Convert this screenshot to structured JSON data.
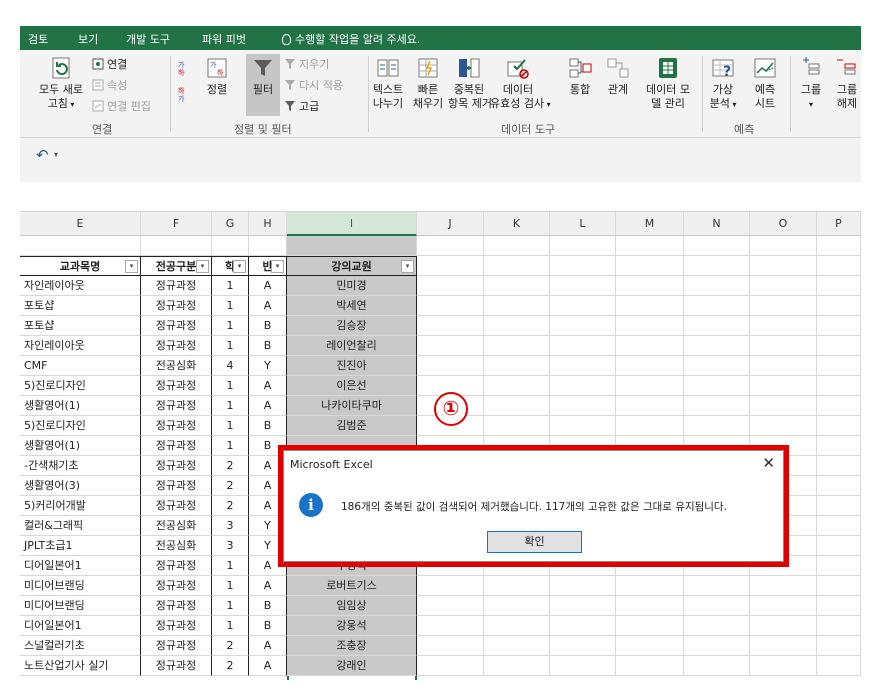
{
  "tabs": [
    "검토",
    "보기",
    "개발 도구",
    "파워 피벗"
  ],
  "tell_me": "수행할 작업을 알려 주세요.",
  "ribbon": {
    "refresh_all": "모두 새로",
    "refresh_all_2": "고침",
    "connections": "연결",
    "properties": "속성",
    "edit_links": "연결 편집",
    "group_connections": "연결",
    "sort": "정렬",
    "filter": "필터",
    "clear": "지우기",
    "reapply": "다시 적용",
    "advanced": "고급",
    "group_sort_filter": "정렬 및 필터",
    "text_to_columns": "텍스트",
    "text_to_columns_2": "나누기",
    "flash_fill": "빠른",
    "flash_fill_2": "채우기",
    "remove_duplicates": "중복된",
    "remove_duplicates_2": "항목 제거",
    "data_validation": "데이터",
    "data_validation_2": "유효성 검사",
    "consolidate": "통합",
    "relationships": "관계",
    "data_model": "데이터 모",
    "data_model_2": "델 관리",
    "group_data_tools": "데이터 도구",
    "what_if": "가상",
    "what_if_2": "분석",
    "forecast": "예측",
    "forecast_2": "시트",
    "group_forecast": "예측",
    "group_btn": "그룹",
    "ungroup": "그룹",
    "ungroup_2": "해제"
  },
  "columns": [
    "E",
    "F",
    "G",
    "H",
    "I",
    "J",
    "K",
    "L",
    "M",
    "N",
    "O",
    "P"
  ],
  "table": {
    "headers": [
      "교과목명",
      "전공구분",
      "학",
      "반",
      "강의교원"
    ],
    "rows": [
      [
        "자인레이아웃",
        "정규과정",
        "1",
        "A",
        "민미경"
      ],
      [
        "포토샵",
        "정규과정",
        "1",
        "A",
        "박세연"
      ],
      [
        "포토샵",
        "정규과정",
        "1",
        "B",
        "김승장"
      ],
      [
        "자인레이아웃",
        "정규과정",
        "1",
        "B",
        "레이언찰리"
      ],
      [
        "CMF",
        "전공심화",
        "4",
        "Y",
        "진진아"
      ],
      [
        "5)진로디자인",
        "정규과정",
        "1",
        "A",
        "이은선"
      ],
      [
        "생활영어(1)",
        "정규과정",
        "1",
        "A",
        "나카이타쿠마"
      ],
      [
        "5)진로디자인",
        "정규과정",
        "1",
        "B",
        "김범준"
      ],
      [
        "생활영어(1)",
        "정규과정",
        "1",
        "B",
        ""
      ],
      [
        "-간색채기초",
        "정규과정",
        "2",
        "A",
        ""
      ],
      [
        "생활영어(3)",
        "정규과정",
        "2",
        "A",
        ""
      ],
      [
        "5)커리어개발",
        "정규과정",
        "2",
        "A",
        ""
      ],
      [
        "컬러&그래픽",
        "전공심화",
        "3",
        "Y",
        ""
      ],
      [
        "JPLT초급1",
        "전공심화",
        "3",
        "Y",
        ""
      ],
      [
        "디어일본어1",
        "정규과정",
        "1",
        "A",
        "주영식"
      ],
      [
        "미디어브랜딩",
        "정규과정",
        "1",
        "A",
        "로버트기스"
      ],
      [
        "미디어브랜딩",
        "정규과정",
        "1",
        "B",
        "임임상"
      ],
      [
        "디어일본어1",
        "정규과정",
        "1",
        "B",
        "강웅석"
      ],
      [
        "스널컬러기초",
        "정규과정",
        "2",
        "A",
        "조충장"
      ],
      [
        "노트산업기사 실기",
        "정규과정",
        "2",
        "A",
        "강래인"
      ]
    ]
  },
  "annotation": {
    "marker": "①"
  },
  "dialog": {
    "title": "Microsoft Excel",
    "close": "✕",
    "message": "186개의 중복된 값이 검색되어 제거했습니다. 117개의 고유한 값은 그대로 유지됩니다.",
    "ok": "확인"
  }
}
